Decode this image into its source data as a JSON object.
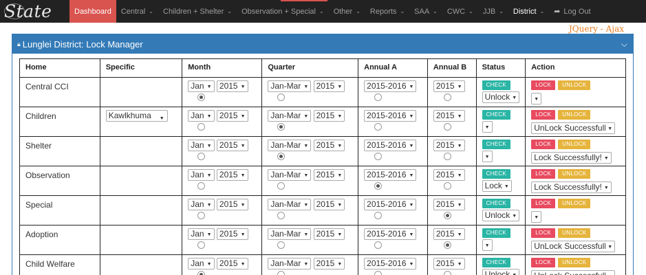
{
  "brand": "State",
  "nav": [
    {
      "label": "Dashboard",
      "active": true,
      "caret": false
    },
    {
      "label": "Central",
      "caret": true
    },
    {
      "label": "Children + Shelter",
      "caret": true
    },
    {
      "label": "Observation + Special",
      "caret": true
    },
    {
      "label": "Other",
      "caret": true
    },
    {
      "label": "Reports",
      "caret": true
    },
    {
      "label": "SAA",
      "caret": true
    },
    {
      "label": "CWC",
      "caret": true
    },
    {
      "label": "JJB",
      "caret": true
    },
    {
      "label": "District",
      "caret": true,
      "bold": true
    },
    {
      "label": "Log Out",
      "caret": false,
      "icon": "logout-icon"
    }
  ],
  "jquery_label": "JQuery - Ajax",
  "panel": {
    "title": "Lunglei District: Lock Manager",
    "title_icon": "lock-icon",
    "collapse_icon": "chevron-down-icon"
  },
  "table": {
    "headers": [
      "Home",
      "Specific",
      "Month",
      "Quarter",
      "Annual A",
      "Annual B",
      "Status",
      "Action"
    ],
    "check_label": "CHECK",
    "lock_label": "LOCK",
    "unlock_label": "UNLOCK",
    "rows": [
      {
        "home": "Central CCI",
        "specific": "",
        "month": "Jan",
        "month_year": "2015",
        "quarter": "Jan-Mar",
        "quarter_year": "2015",
        "annual_a": "2015-2016",
        "annual_b": "2015",
        "selected_radio": "month",
        "status": "Unlock",
        "action": ""
      },
      {
        "home": "Children",
        "specific": "Kawlkhuma",
        "month": "Jan",
        "month_year": "2015",
        "quarter": "Jan-Mar",
        "quarter_year": "2015",
        "annual_a": "2015-2016",
        "annual_b": "2015",
        "selected_radio": "quarter",
        "status": "",
        "action": "UnLock Successfully!"
      },
      {
        "home": "Shelter",
        "specific": "",
        "month": "Jan",
        "month_year": "2015",
        "quarter": "Jan-Mar",
        "quarter_year": "2015",
        "annual_a": "2015-2016",
        "annual_b": "2015",
        "selected_radio": "quarter",
        "status": "",
        "action": "Lock Successfully!"
      },
      {
        "home": "Observation",
        "specific": "",
        "month": "Jan",
        "month_year": "2015",
        "quarter": "Jan-Mar",
        "quarter_year": "2015",
        "annual_a": "2015-2016",
        "annual_b": "2015",
        "selected_radio": "annual_a",
        "status": "Lock",
        "action": "Lock Successfully!"
      },
      {
        "home": "Special",
        "specific": "",
        "month": "Jan",
        "month_year": "2015",
        "quarter": "Jan-Mar",
        "quarter_year": "2015",
        "annual_a": "2015-2016",
        "annual_b": "2015",
        "selected_radio": "annual_b",
        "status": "Unlock",
        "action": ""
      },
      {
        "home": "Adoption",
        "specific": "",
        "month": "Jan",
        "month_year": "2015",
        "quarter": "Jan-Mar",
        "quarter_year": "2015",
        "annual_a": "2015-2016",
        "annual_b": "2015",
        "selected_radio": "annual_b",
        "status": "",
        "action": "UnLock Successfully!"
      },
      {
        "home": "Child Welfare",
        "specific": "",
        "month": "Jan",
        "month_year": "2015",
        "quarter": "Jan-Mar",
        "quarter_year": "2015",
        "annual_a": "2015-2016",
        "annual_b": "2015",
        "selected_radio": "month",
        "status": "Unlock",
        "action": "UnLock Successfully!"
      }
    ]
  },
  "colors": {
    "navbar_bg": "#222222",
    "active_nav": "#d9534f",
    "panel_primary": "#337ab7",
    "check_button": "#2ab5a5",
    "lock_button": "#e84a5f",
    "unlock_button": "#e6b43c",
    "ajax_label": "#e67e22"
  }
}
